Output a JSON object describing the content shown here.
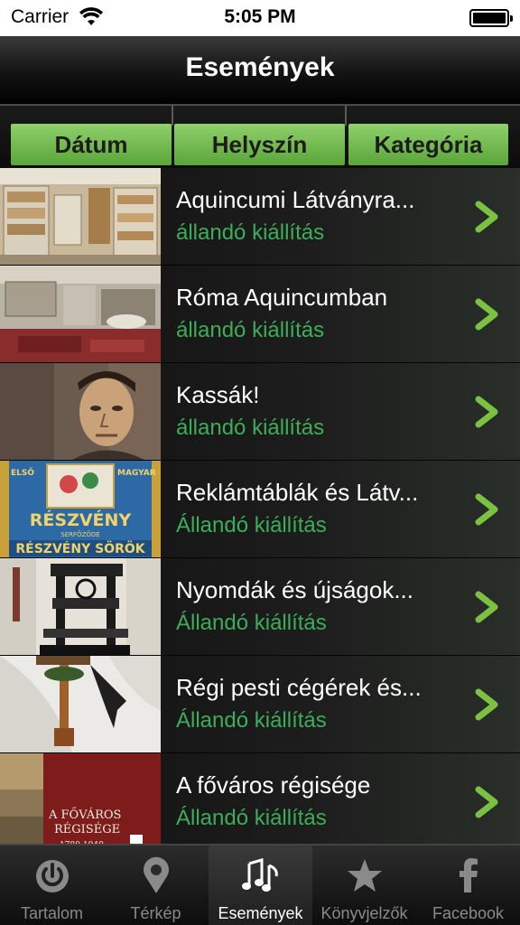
{
  "status_bar": {
    "carrier": "Carrier",
    "time": "5:05 PM"
  },
  "nav": {
    "title": "Események"
  },
  "segments": [
    {
      "label": "Dátum"
    },
    {
      "label": "Helyszín"
    },
    {
      "label": "Kategória"
    }
  ],
  "list": [
    {
      "title": "Aquincumi Látványra...",
      "subtitle": "állandó kiállítás",
      "image": "museum-exhibition-thumbnail"
    },
    {
      "title": "Róma Aquincumban",
      "subtitle": "állandó kiállítás",
      "image": "roman-room-thumbnail"
    },
    {
      "title": "Kassák!",
      "subtitle": "állandó kiállítás",
      "image": "portrait-painting-thumbnail"
    },
    {
      "title": "Reklámtáblák és Látv...",
      "subtitle": "Állandó kiállítás",
      "image": "beer-advert-thumbnail",
      "image_text": {
        "top_left": "ELSŐ",
        "top_right": "MAGYAR",
        "main": "RÉSZVÉNY",
        "small": "SERFŐZŐDE",
        "bottom": "RÉSZVÉNY SÖRÖK"
      }
    },
    {
      "title": "Nyomdák és újságok...",
      "subtitle": "Állandó kiállítás",
      "image": "printing-press-thumbnail"
    },
    {
      "title": "Régi pesti cégérek és...",
      "subtitle": "Állandó kiállítás",
      "image": "shop-sign-thumbnail"
    },
    {
      "title": "A főváros régisége",
      "subtitle": "Állandó kiállítás",
      "image": "book-cover-thumbnail",
      "image_text": {
        "line1": "A FŐVÁROS",
        "line2": "RÉGISÉGE",
        "line3": "1780-1940"
      }
    }
  ],
  "tabs": [
    {
      "label": "Tartalom",
      "icon": "power-icon",
      "active": false
    },
    {
      "label": "Térkép",
      "icon": "map-pin-icon",
      "active": false
    },
    {
      "label": "Események",
      "icon": "music-notes-icon",
      "active": true
    },
    {
      "label": "Könyvjelzők",
      "icon": "star-icon",
      "active": false
    },
    {
      "label": "Facebook",
      "icon": "facebook-icon",
      "active": false
    }
  ],
  "colors": {
    "accent_green": "#6dbb4a",
    "subtitle_green": "#3cae58",
    "chevron_green": "#7cc242"
  }
}
